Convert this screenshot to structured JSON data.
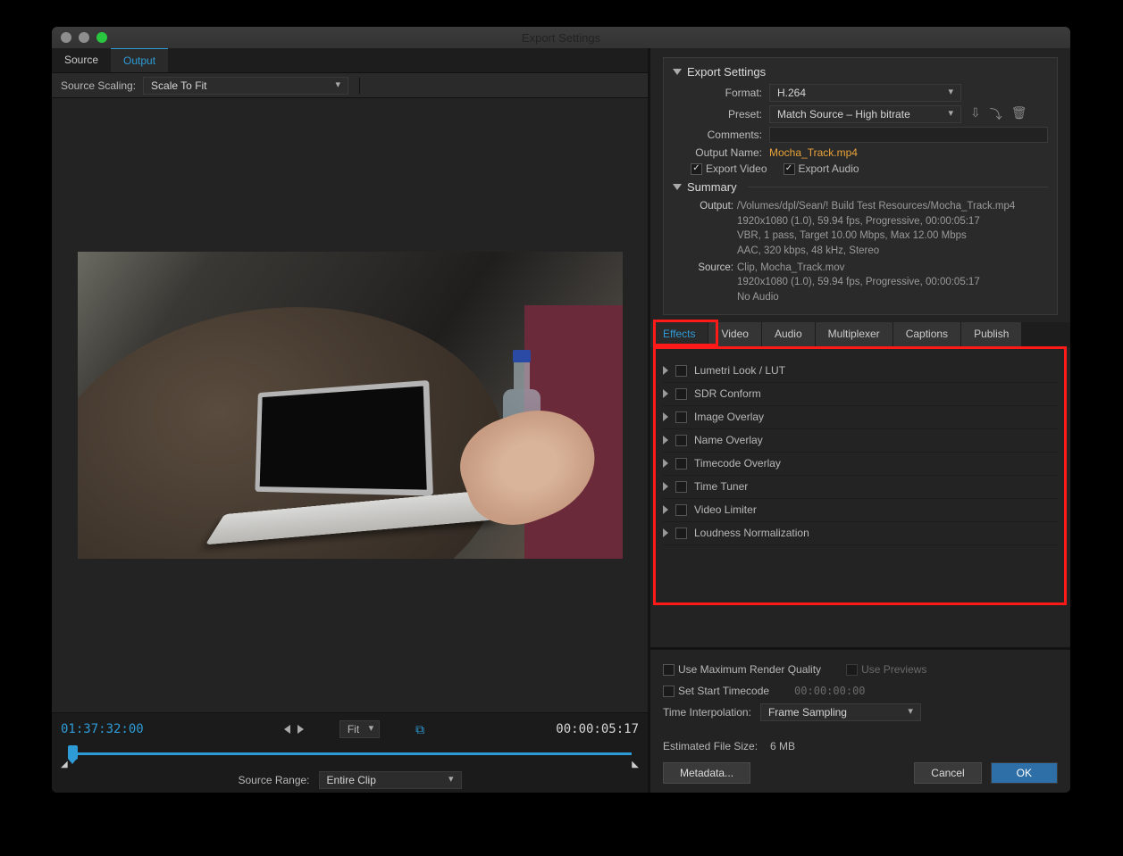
{
  "window": {
    "title": "Export Settings"
  },
  "leftTabs": {
    "source": "Source",
    "output": "Output"
  },
  "sourceScaling": {
    "label": "Source Scaling:",
    "value": "Scale To Fit"
  },
  "playbar": {
    "currentTC": "01:37:32:00",
    "durationTC": "00:00:05:17",
    "zoom": "Fit",
    "rangeLabel": "Source Range:",
    "rangeValue": "Entire Clip"
  },
  "exportSettings": {
    "heading": "Export Settings",
    "formatLabel": "Format:",
    "formatValue": "H.264",
    "presetLabel": "Preset:",
    "presetValue": "Match Source – High bitrate",
    "commentsLabel": "Comments:",
    "commentsValue": "",
    "outputNameLabel": "Output Name:",
    "outputNameValue": "Mocha_Track.mp4",
    "exportVideo": "Export Video",
    "exportAudio": "Export Audio",
    "summaryHeading": "Summary",
    "output": {
      "label": "Output:",
      "line1": "/Volumes/dpl/Sean/! Build Test Resources/Mocha_Track.mp4",
      "line2": "1920x1080 (1.0), 59.94 fps, Progressive, 00:00:05:17",
      "line3": "VBR, 1 pass, Target 10.00 Mbps, Max 12.00 Mbps",
      "line4": "AAC, 320 kbps, 48 kHz, Stereo"
    },
    "source": {
      "label": "Source:",
      "line1": "Clip, Mocha_Track.mov",
      "line2": "1920x1080 (1.0), 59.94 fps, Progressive, 00:00:05:17",
      "line3": "No Audio"
    }
  },
  "tabs": [
    "Effects",
    "Video",
    "Audio",
    "Multiplexer",
    "Captions",
    "Publish"
  ],
  "effects": [
    "Lumetri Look / LUT",
    "SDR Conform",
    "Image Overlay",
    "Name Overlay",
    "Timecode Overlay",
    "Time Tuner",
    "Video Limiter",
    "Loudness Normalization"
  ],
  "render": {
    "maxQuality": "Use Maximum Render Quality",
    "usePreviews": "Use Previews",
    "setStartTC": "Set Start Timecode",
    "startTCValue": "00:00:00:00",
    "timeInterpLabel": "Time Interpolation:",
    "timeInterpValue": "Frame Sampling",
    "estSizeLabel": "Estimated File Size:",
    "estSizeValue": "6 MB"
  },
  "buttons": {
    "metadata": "Metadata...",
    "cancel": "Cancel",
    "ok": "OK"
  }
}
